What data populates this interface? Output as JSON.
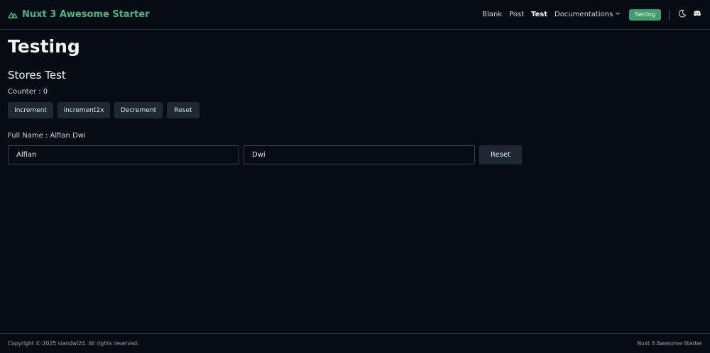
{
  "header": {
    "brand": "Nuxt 3 Awesome Starter",
    "nav": [
      {
        "label": "Blank",
        "active": false
      },
      {
        "label": "Post",
        "active": false
      },
      {
        "label": "Test",
        "active": true
      }
    ],
    "documentations_label": "Documentations",
    "setting_label": "Setting",
    "accent_color": "#41b883",
    "icons": [
      "moon-icon",
      "discord-icon"
    ]
  },
  "main": {
    "title": "Testing",
    "section_title": "Stores Test",
    "counter_text": "Counter : 0",
    "buttons": {
      "increment": "Increment",
      "increment2x": "increment2x",
      "decrement": "Decrement",
      "reset": "Reset"
    },
    "fullname_text": "Full Name : Alfian Dwi",
    "first_name_value": "Alfian",
    "last_name_value": "Dwi",
    "name_reset": "Reset"
  },
  "footer": {
    "copyright": "Copyright © 2025 viandwi24. All rights reserved.",
    "app_name": "Nuxt 3 Awesome Starter"
  }
}
